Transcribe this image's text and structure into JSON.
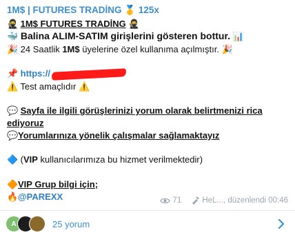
{
  "header": {
    "title": "1M$ | FUTURES TRADİNG 🥇 125x"
  },
  "post": {
    "line1_text": "1M$ FUTURES TRADİNG",
    "line2_text": "Balina ALIM-SATIM girişlerini gösteren bottur.",
    "line3_pre": "24 Saatlik ",
    "line3_bold": "1M$",
    "line3_post": " üyelerine özel kullanıma açılmıştır.",
    "link_text": "https://",
    "warning_text": "Test amaçlıdır",
    "feedback_text": "Sayfa ile ilgili görüşlerinizi yorum olarak belirtmenizi rica",
    "feedback_text2": "ediyoruz",
    "improve_text": "Yorumlarınıza yönelik çalışmalar sağlamaktayız",
    "vip_pre": "(",
    "vip_bold": "VIP",
    "vip_post": " kullanıcılarımıza bu hizmet verilmektedir)",
    "vip_group_text": "VIP Grup bilgi için;",
    "contact_text": "@PAREXX"
  },
  "meta": {
    "views": "71",
    "author_edit": "HeL..., düzenlendi 00:46"
  },
  "comments": {
    "avatar_initial": "A",
    "label": "25 yorum"
  },
  "colors": {
    "accent": "#3a8fd0",
    "redaction": "#ff1a1a"
  },
  "icons": [
    "ninja-icon",
    "whale-icon",
    "chart-icon",
    "party-icon",
    "pin-icon",
    "warning-icon",
    "speech-bubble-icon",
    "blue-diamond-icon",
    "orange-diamond-icon",
    "fire-icon",
    "eye-icon",
    "author-icon",
    "chevron-right-icon"
  ]
}
